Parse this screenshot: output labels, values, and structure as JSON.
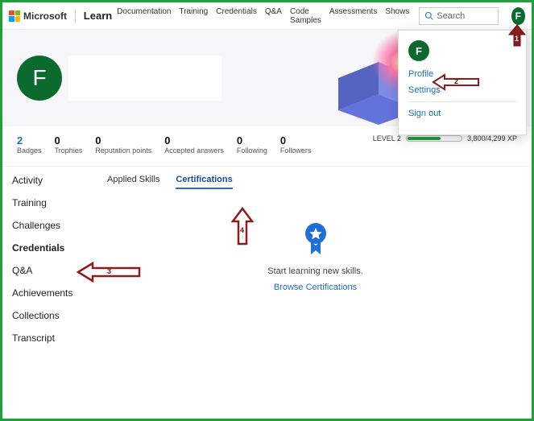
{
  "brand": {
    "name": "Microsoft",
    "product": "Learn"
  },
  "nav": {
    "items": [
      "Documentation",
      "Training",
      "Credentials",
      "Q&A",
      "Code Samples",
      "Assessments",
      "Shows"
    ],
    "search_placeholder": "Search"
  },
  "user": {
    "initial": "F"
  },
  "dropdown": {
    "profile": "Profile",
    "settings": "Settings",
    "signout": "Sign out"
  },
  "stats": [
    {
      "value": "2",
      "label": "Badges",
      "highlight": true
    },
    {
      "value": "0",
      "label": "Trophies"
    },
    {
      "value": "0",
      "label": "Reputation points"
    },
    {
      "value": "0",
      "label": "Accepted answers"
    },
    {
      "value": "0",
      "label": "Following"
    },
    {
      "value": "0",
      "label": "Followers"
    }
  ],
  "level": {
    "label": "LEVEL 2",
    "xp": "3,800/4,299 XP"
  },
  "sidenav": [
    "Activity",
    "Training",
    "Challenges",
    "Credentials",
    "Q&A",
    "Achievements",
    "Collections",
    "Transcript"
  ],
  "sidenav_active_index": 3,
  "subtabs": {
    "applied": "Applied Skills",
    "certs": "Certifications"
  },
  "empty": {
    "text": "Start learning new skills.",
    "link": "Browse Certifications"
  },
  "annotations": {
    "a1": "1",
    "a2": "2",
    "a3": "3",
    "a4": "4"
  }
}
